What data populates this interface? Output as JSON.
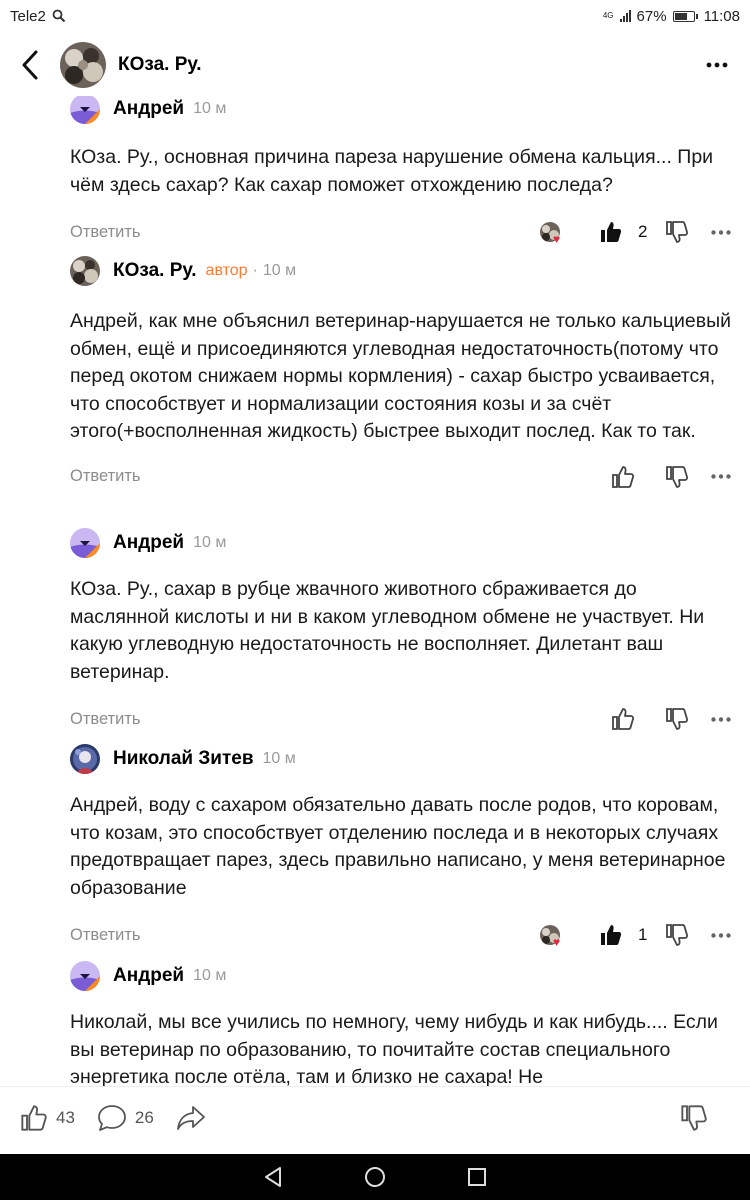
{
  "status_bar": {
    "carrier": "Tele2",
    "network": "4G",
    "battery": "67%",
    "battery_level": 0.67,
    "time": "11:08"
  },
  "header": {
    "title": "КОза. Ру."
  },
  "comments": [
    {
      "author": "Андрей",
      "time": "10 м",
      "text": "КОза. Ру., основная причина пареза нарушение обмена кальция... При чём здесь сахар? Как сахар поможет отхождению последа?",
      "reply_label": "Ответить",
      "likes": "2",
      "has_reactor": true
    },
    {
      "author": "КОза. Ру.",
      "badge": "автор",
      "time": "10 м",
      "text": "Андрей, как мне объяснил ветеринар-нарушается не только кальциевый обмен, ещё и присоединяются углеводная недостаточность(потому что перед окотом снижаем нормы кормления) - сахар быстро усваивается, что способствует и нормализации состояния козы и за счёт этого(+восполненная жидкость) быстрее выходит послед. Как то так.",
      "reply_label": "Ответить"
    },
    {
      "author": "Андрей",
      "time": "10 м",
      "text": "КОза. Ру., сахар в рубце жвачного животного сбраживается до маслянной кислоты и ни в каком углеводном обмене не участвует. Ни какую углеводную недостаточность не восполняет. Дилетант ваш ветеринар.",
      "reply_label": "Ответить"
    },
    {
      "author": "Николай Зитев",
      "time": "10 м",
      "text": "Андрей, воду с сахаром обязательно давать после родов, что коровам, что козам, это способствует отделению последа и в некоторых случаях предотвращает парез, здесь правильно написано, у меня ветеринарное образование",
      "reply_label": "Ответить",
      "likes": "1",
      "has_reactor": true
    },
    {
      "author": "Андрей",
      "time": "10 м",
      "text": "Николай, мы все учились по немногу, чему нибудь и как нибудь.... Если вы ветеринар по образованию, то почитайте состав специального энергетика после отёла, там и близко не сахара! Не"
    }
  ],
  "bottom_bar": {
    "likes": "43",
    "comments": "26"
  },
  "colors": {
    "author_badge": "#ff7a2e",
    "andrey_avatar_bg": "#c9b8f2",
    "andrey_avatar_accent": "#ff8a1f",
    "heart": "#e0283c"
  },
  "icons": [
    "back-arrow-icon",
    "more-dots-icon",
    "thumbs-up-icon",
    "thumbs-down-icon",
    "comment-bubble-icon",
    "share-arrow-icon",
    "nav-back-icon",
    "nav-home-icon",
    "nav-recents-icon"
  ]
}
